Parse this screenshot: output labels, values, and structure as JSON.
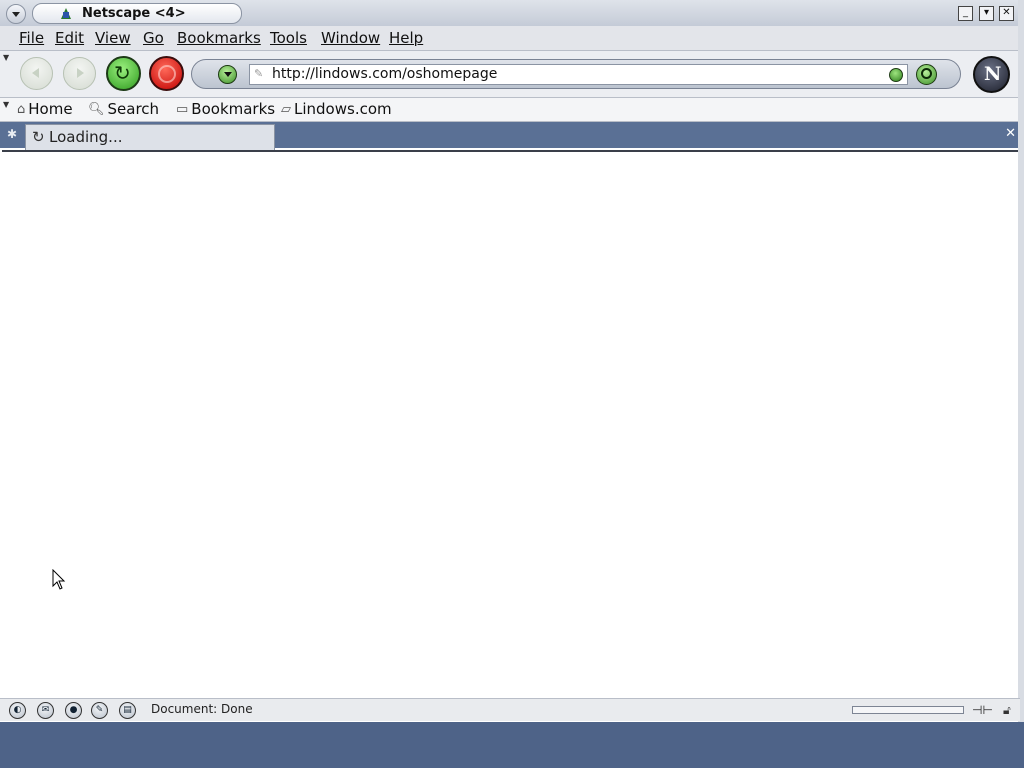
{
  "window": {
    "title": "Netscape <4>",
    "controls": [
      "minimize",
      "maximize",
      "close"
    ]
  },
  "menubar": {
    "items": [
      "File",
      "Edit",
      "View",
      "Go",
      "Bookmarks",
      "Tools",
      "Window",
      "Help"
    ]
  },
  "navigation": {
    "back_icon": "back-arrow-icon",
    "forward_icon": "forward-arrow-icon",
    "reload_icon": "reload-icon",
    "stop_icon": "stop-icon",
    "url": "http://lindows.com/oshomepage"
  },
  "personal_toolbar": {
    "items": [
      "Home",
      "Search",
      "Bookmarks",
      "Lindows.com"
    ]
  },
  "tabs": {
    "active_label": "Loading..."
  },
  "status": {
    "text": "Document: Done"
  },
  "colors": {
    "tabbar_bg": "#5a7095",
    "desktop_bg": "#4e6388",
    "reload_green": "#2f9b1f",
    "stop_red": "#c00000"
  }
}
